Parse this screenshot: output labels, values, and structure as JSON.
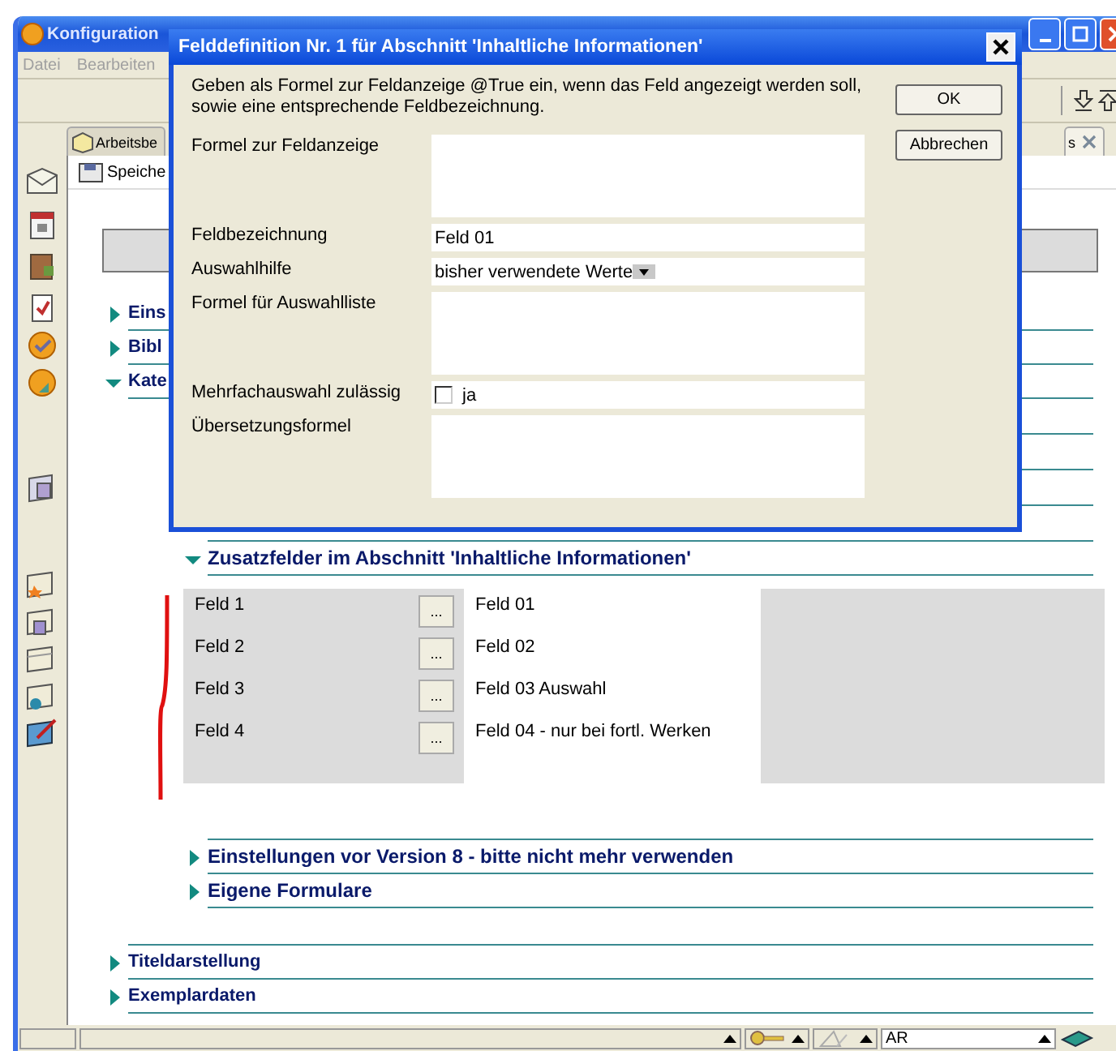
{
  "window": {
    "title": "Konfiguration"
  },
  "menu": [
    "Datei",
    "Bearbeiten"
  ],
  "tabs": [
    {
      "label": "Arbeitsbe",
      "selected": false
    },
    {
      "label": "s",
      "selected": true
    }
  ],
  "subtoolbar": {
    "button": "Speiche"
  },
  "sections": [
    {
      "title": "Eins",
      "expanded": false
    },
    {
      "title": "Bibl",
      "expanded": false
    },
    {
      "title": "Kate",
      "expanded": true,
      "children": [
        {
          "title": "Zusatzfelder im Abschnitt 'Inhaltliche Informationen'",
          "expanded": true,
          "fields": [
            {
              "label": "Feld 1",
              "button": "...",
              "value": "Feld 01"
            },
            {
              "label": "Feld 2",
              "button": "...",
              "value": "Feld 02"
            },
            {
              "label": "Feld 3",
              "button": "...",
              "value": "Feld 03 Auswahl"
            },
            {
              "label": "Feld 4",
              "button": "...",
              "value": "Feld 04 - nur bei fortl. Werken"
            }
          ]
        },
        {
          "title": "Einstellungen vor Version 8 - bitte nicht mehr verwenden",
          "expanded": false
        },
        {
          "title": "Eigene Formulare",
          "expanded": false
        }
      ]
    },
    {
      "title": "Titeldarstellung",
      "expanded": false
    },
    {
      "title": "Exemplardaten",
      "expanded": false
    }
  ],
  "status_bar": {
    "field": "AR"
  },
  "dialog": {
    "title": "Felddefinition Nr. 1 für Abschnitt 'Inhaltliche Informationen'",
    "message": "Geben als Formel zur Feldanzeige @True ein, wenn das Feld angezeigt werden soll, sowie eine entsprechende Feldbezeichnung.",
    "buttons": [
      "OK",
      "Abbrechen"
    ],
    "fields": [
      {
        "kind": "textarea",
        "label": "Formel zur Feldanzeige"
      },
      {
        "kind": "text",
        "label": "Feldbezeichnung",
        "value": "Feld 01"
      },
      {
        "kind": "select",
        "label": "Auswahlhilfe",
        "value": "bisher verwendete Werte"
      },
      {
        "kind": "textarea",
        "label": "Formel für Auswahlliste"
      },
      {
        "kind": "checkbox",
        "label": "Mehrfachauswahl zulässig",
        "option": "ja",
        "checked": false
      },
      {
        "kind": "textarea",
        "label": "Übersetzungsformel"
      }
    ]
  }
}
